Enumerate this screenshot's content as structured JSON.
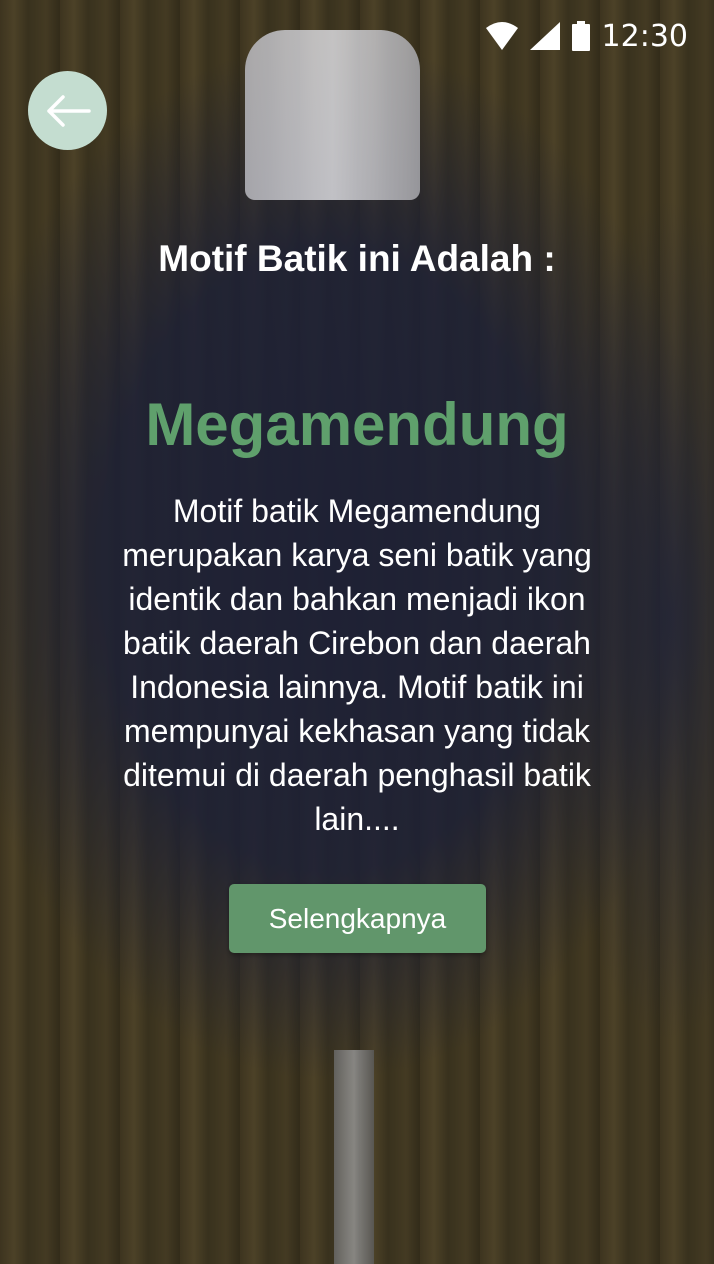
{
  "status_bar": {
    "time": "12:30",
    "icons": [
      "wifi-icon",
      "signal-icon",
      "battery-icon"
    ]
  },
  "navigation": {
    "back_icon": "arrow-left-icon"
  },
  "content": {
    "heading": "Motif Batik ini Adalah :",
    "motif_name": "Megamendung",
    "description": "Motif batik Megamendung merupakan karya seni batik yang identik dan bahkan menjadi ikon batik daerah Cirebon dan daerah Indonesia lainnya. Motif batik ini mempunyai kekhasan yang tidak ditemui di daerah penghasil batik lain....",
    "button_label": "Selengkapnya"
  },
  "colors": {
    "accent_green": "#5fa06c",
    "button_green": "#61966b",
    "back_button_bg": "#c4ddd0"
  }
}
